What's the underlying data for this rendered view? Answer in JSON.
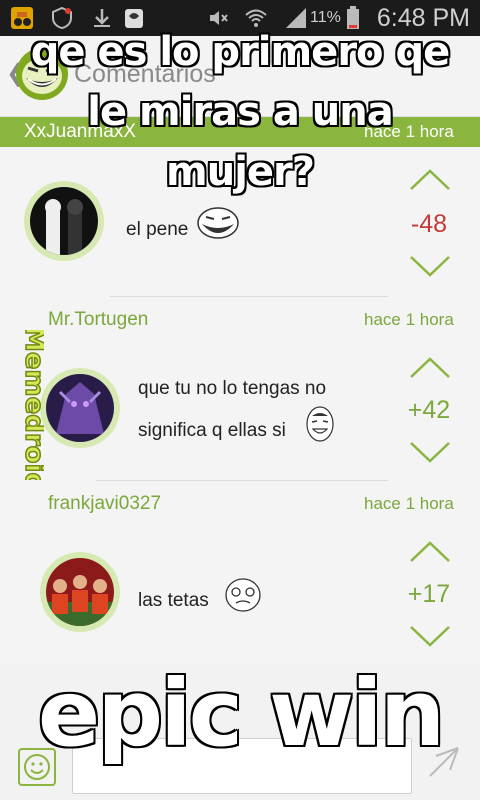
{
  "status_bar": {
    "time": "6:48 PM",
    "battery_percent": "11%",
    "icons": [
      "game-app-icon",
      "shield-icon",
      "download-icon",
      "clipboard-icon",
      "mute-icon",
      "wifi-icon",
      "signal-icon",
      "battery-icon"
    ]
  },
  "action_bar": {
    "title": "Comentarios",
    "back_icon": "back-arrow-icon",
    "logo": "troll-face-logo"
  },
  "meme": {
    "top_caption": "qe es lo primero qe le miras a una mujer?",
    "bottom_caption": "epic win",
    "watermark": "Memedroid"
  },
  "comments": [
    {
      "user": "XxJuanmaxX",
      "time": "hace 1 hora",
      "text": "el pene",
      "score": "-48",
      "score_color": "#c23b3b",
      "avatar": "long-cat-avatar",
      "emoji": "troll-face"
    },
    {
      "user": "Mr.Tortugen",
      "time": "hace 1 hora",
      "text_line1": "que tu no lo tengas no",
      "text_line2": "significa q ellas si",
      "score": "+42",
      "score_color": "#7aa83a",
      "avatar": "purple-creature-avatar",
      "emoji": "yao-ming-face"
    },
    {
      "user": "frankjavi0327",
      "time": "hace 1 hora",
      "text": "las tetas",
      "score": "+17",
      "score_color": "#7aa83a",
      "avatar": "football-team-avatar",
      "emoji": "me-gusta-face"
    }
  ],
  "colors": {
    "accent": "#8ab53f",
    "negative": "#c23b3b",
    "positive": "#7aa83a"
  },
  "input": {
    "smiley_icon": "smiley-icon",
    "send_icon": "send-icon",
    "placeholder": ""
  }
}
